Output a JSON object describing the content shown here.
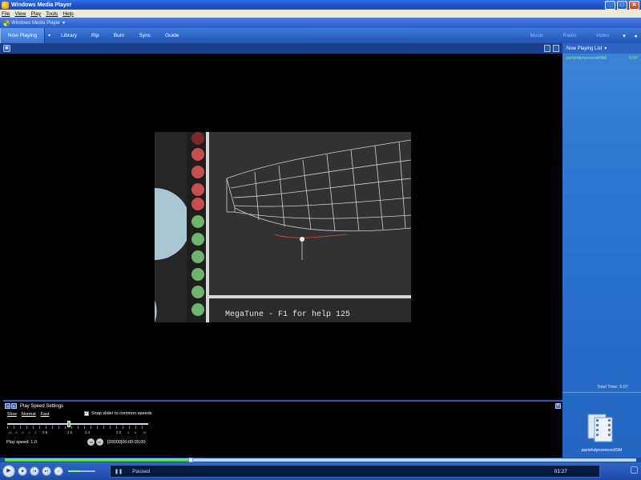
{
  "window": {
    "title": "Windows Media Player"
  },
  "menu": [
    "File",
    "View",
    "Play",
    "Tools",
    "Help"
  ],
  "skin_title": "Windows Media Player",
  "taskbar": {
    "tabs": [
      "Now Playing",
      "Library",
      "Rip",
      "Burn",
      "Sync",
      "Guide"
    ],
    "arrow": "▾",
    "media_tabs": [
      "Music",
      "Radio",
      "Video"
    ]
  },
  "video": {
    "caption": "MegaTune - F1 for help 125"
  },
  "playlist": {
    "header": "Now Playing List",
    "items": [
      {
        "title": "parishdynorecordSM",
        "duration": "5:07"
      }
    ],
    "total_time": "Total Time: 5:07",
    "album_name": "parishdynorecordSM"
  },
  "enhancements": {
    "title": "Play Speed Settings",
    "links": [
      "Slow",
      "Normal",
      "Fast"
    ],
    "snap_label": "Snap slider to common speeds",
    "snap_checked": true,
    "ticks": [
      "-16",
      "-8",
      "-4",
      "-2",
      "-1",
      "0.5",
      "1.0",
      "1.4",
      "2.0",
      "4",
      "8",
      "16"
    ],
    "play_speed": "Play speed: 1.0",
    "sync_time": "[00000]00:00:00.00"
  },
  "player": {
    "status": "Paused",
    "time": "01:27",
    "seek_fraction": 0.29,
    "volume_fraction": 0.45
  },
  "colors": {
    "accent": "#2a5cc8",
    "playlist_text": "#7cff6a",
    "seek_fill": "#46c33c"
  }
}
